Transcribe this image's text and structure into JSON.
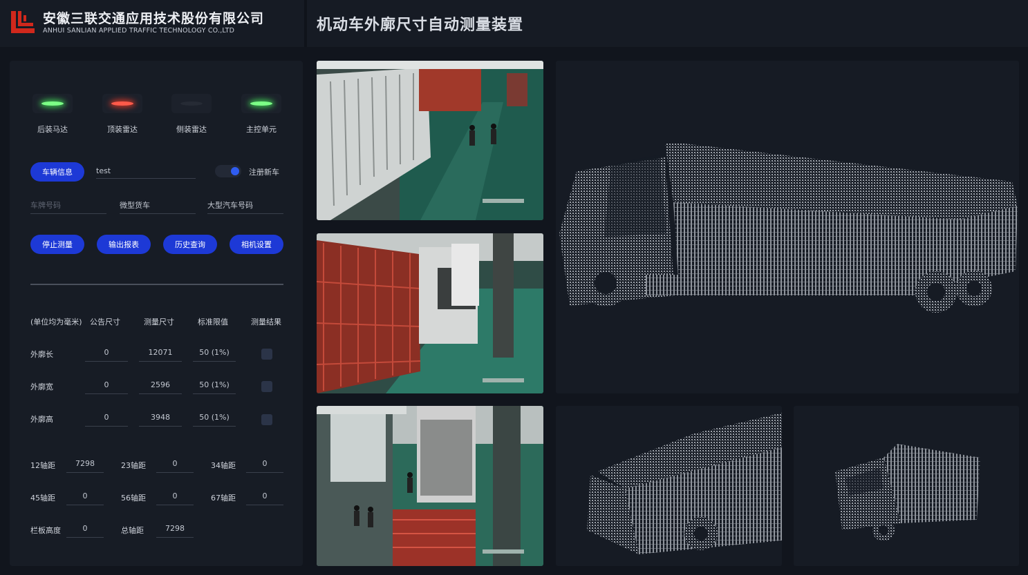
{
  "header": {
    "company_cn": "安徽三联交通应用技术股份有限公司",
    "company_en": "ANHUI SANLIAN APPLIED TRAFFIC TECHNOLOGY CO.,LTD",
    "title": "机动车外廓尺寸自动测量装置"
  },
  "status_lights": [
    {
      "label": "后装马达",
      "state": "green"
    },
    {
      "label": "顶装雷达",
      "state": "red"
    },
    {
      "label": "侧装雷达",
      "state": "off"
    },
    {
      "label": "主控单元",
      "state": "green"
    }
  ],
  "vehicle": {
    "info_button": "车辆信息",
    "name_value": "test",
    "register_label": "注册新车",
    "register_on": true,
    "plate_placeholder": "车牌号码",
    "type_value": "微型货车",
    "plate_kind_value": "大型汽车号码"
  },
  "actions": [
    "停止测量",
    "输出报表",
    "历史查询",
    "相机设置"
  ],
  "measure_table": {
    "headers": [
      "(单位均为毫米)",
      "公告尺寸",
      "测量尺寸",
      "标准限值",
      "测量结果"
    ],
    "rows": [
      {
        "label": "外廓长",
        "announced": "0",
        "measured": "12071",
        "limit": "50 (1%)"
      },
      {
        "label": "外廓宽",
        "announced": "0",
        "measured": "2596",
        "limit": "50 (1%)"
      },
      {
        "label": "外廓高",
        "announced": "0",
        "measured": "3948",
        "limit": "50 (1%)"
      }
    ]
  },
  "axles": [
    {
      "label": "12轴距",
      "value": "7298"
    },
    {
      "label": "23轴距",
      "value": "0"
    },
    {
      "label": "34轴距",
      "value": "0"
    },
    {
      "label": "45轴距",
      "value": "0"
    },
    {
      "label": "56轴距",
      "value": "0"
    },
    {
      "label": "67轴距",
      "value": "0"
    },
    {
      "label": "栏板高度",
      "value": "0"
    },
    {
      "label": "总轴距",
      "value": "7298"
    }
  ],
  "colors": {
    "accent": "#1d39d6",
    "green_light": "#5cf06a",
    "red_light": "#f0422e",
    "background": "#11151d"
  }
}
